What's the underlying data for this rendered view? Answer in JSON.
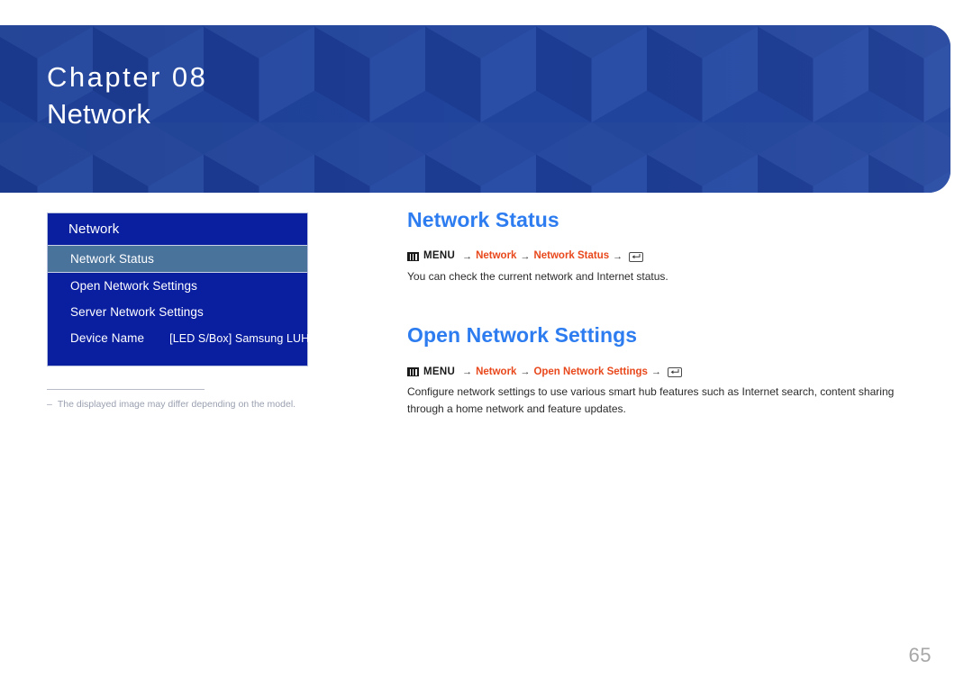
{
  "banner": {
    "chapter_label": "Chapter 08",
    "chapter_title": "Network",
    "bg_color": "#20439c",
    "pattern": "isometric-cubes"
  },
  "osd": {
    "header_title": "Network",
    "items": [
      {
        "label": "Network Status",
        "value": "",
        "selected": true
      },
      {
        "label": "Open Network Settings",
        "value": "",
        "selected": false
      },
      {
        "label": "Server Network Settings",
        "value": "",
        "selected": false
      },
      {
        "label": "Device Name",
        "value": "[LED S/Box] Samsung LUH Series",
        "selected": false
      }
    ],
    "selected_bg": "#4a739c",
    "panel_bg": "#0a1fa0"
  },
  "footnote": {
    "dash": "–",
    "text": "The displayed image may differ depending on the model."
  },
  "sections": [
    {
      "title": "Network Status",
      "path": {
        "menu_label": "MENU",
        "arrow": "→",
        "crumb1": "Network",
        "crumb2": "Network Status",
        "enter_glyph": "↵",
        "menu_icon": "menu-icon",
        "enter_icon": "enter-key-icon"
      },
      "body": "You can check the current network and Internet status."
    },
    {
      "title": "Open Network Settings",
      "path": {
        "menu_label": "MENU",
        "arrow": "→",
        "crumb1": "Network",
        "crumb2": "Open Network Settings",
        "enter_glyph": "↵",
        "menu_icon": "menu-icon",
        "enter_icon": "enter-key-icon"
      },
      "body": "Configure network settings to use various smart hub features such as Internet search, content sharing through a home network and feature updates."
    }
  ],
  "page_number": "65",
  "colors": {
    "heading_blue": "#2d7cf0",
    "path_highlight": "#e8481c",
    "page_number_gray": "#a7a7a7"
  }
}
